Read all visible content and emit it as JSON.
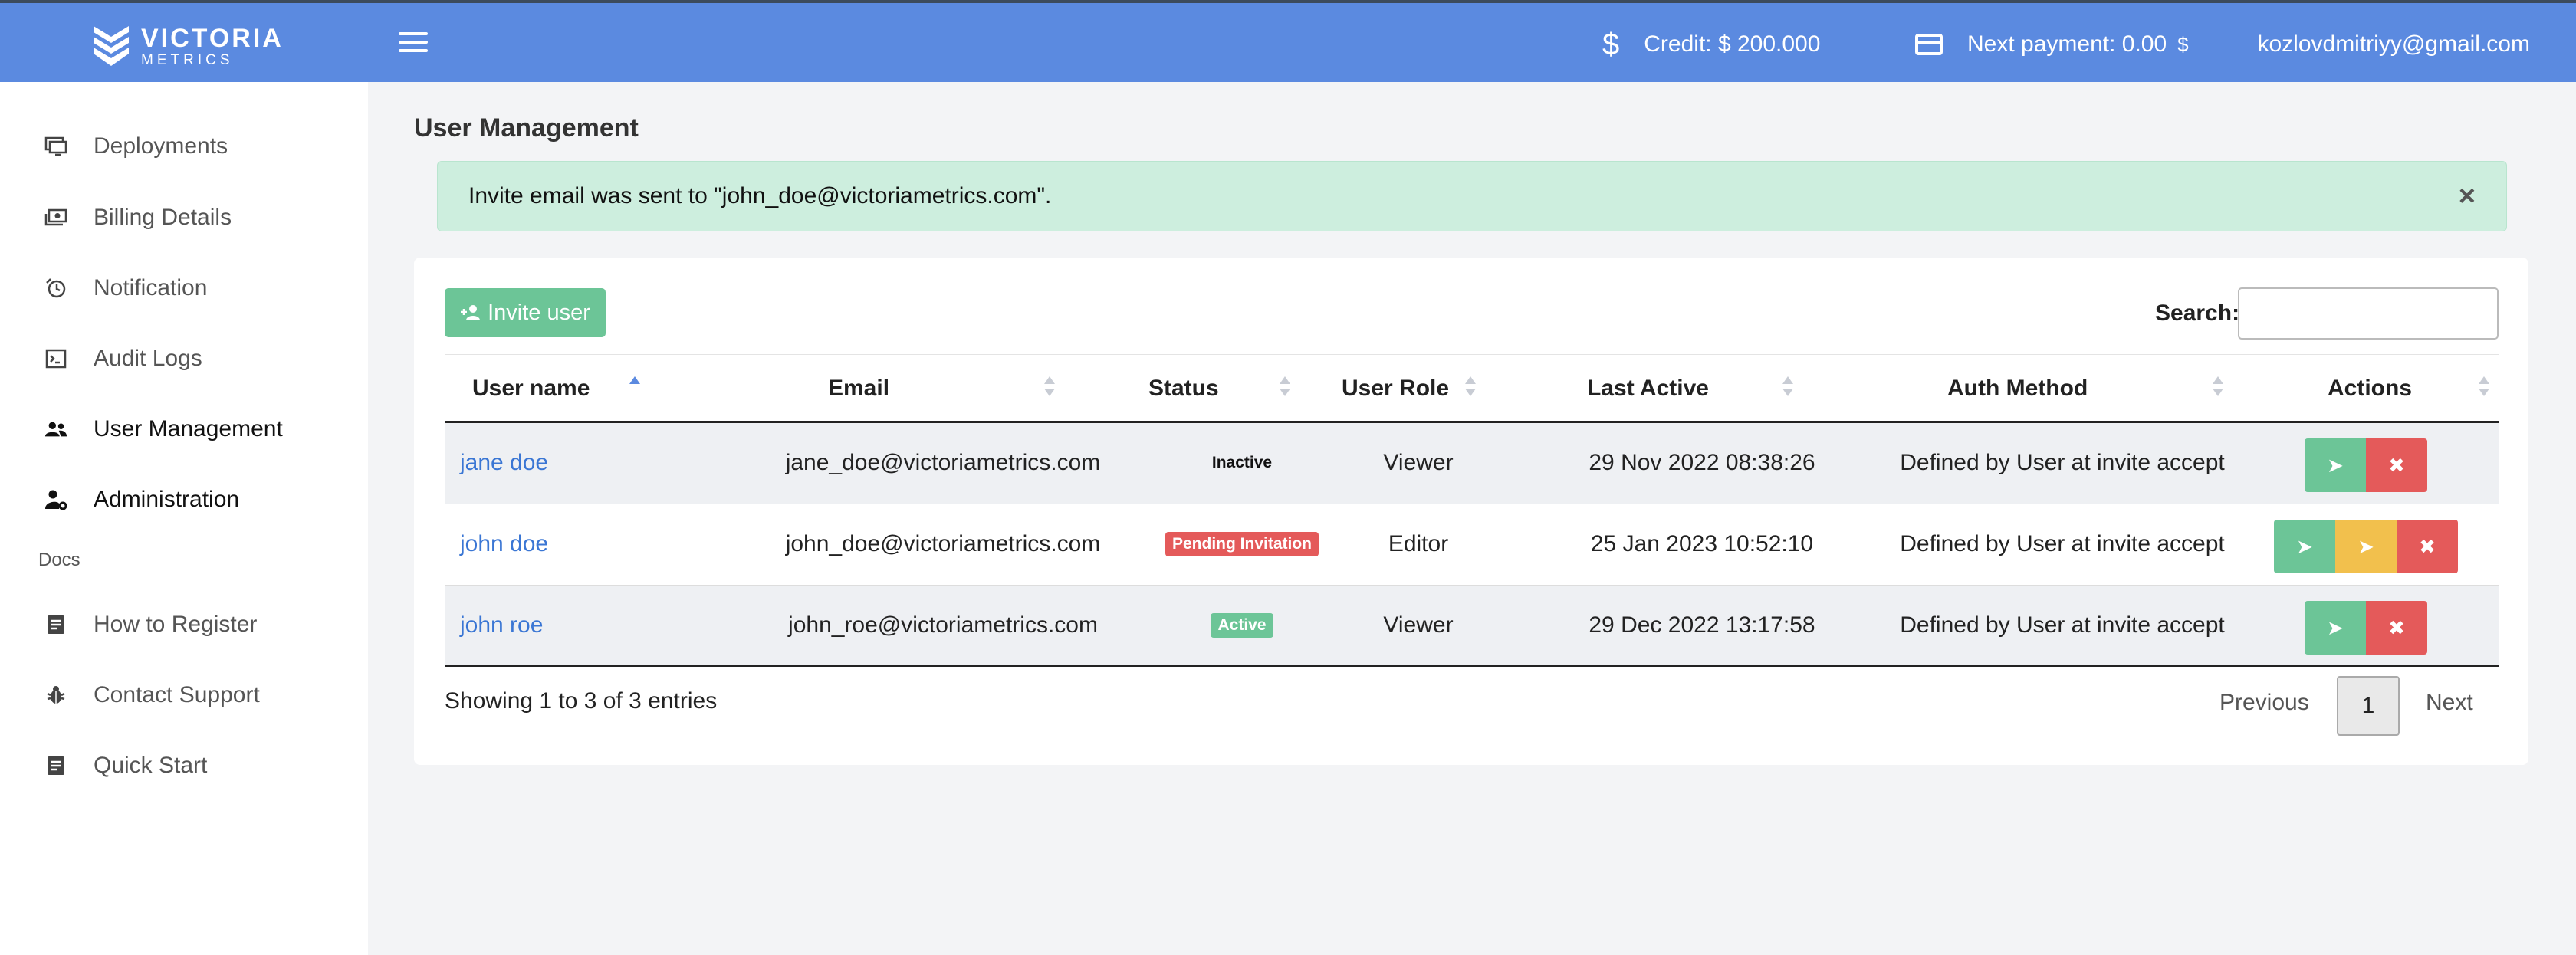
{
  "header": {
    "logo_main": "VICTORIA",
    "logo_sub": "METRICS",
    "credit": "Credit: $ 200.000",
    "next_payment": "Next payment: 0.00",
    "next_payment_currency": "$",
    "user_email": "kozlovdmitriyy@gmail.com",
    "brand_color": "#5b8ae0"
  },
  "sidebar": {
    "items": [
      {
        "label": "Deployments",
        "icon": "monitor-icon"
      },
      {
        "label": "Billing Details",
        "icon": "billing-icon"
      },
      {
        "label": "Notification",
        "icon": "alarm-icon"
      },
      {
        "label": "Audit Logs",
        "icon": "terminal-icon"
      },
      {
        "label": "User Management",
        "icon": "users-icon"
      },
      {
        "label": "Administration",
        "icon": "user-gear-icon"
      }
    ],
    "docs_header": "Docs",
    "docs_items": [
      {
        "label": "How to Register",
        "icon": "document-icon"
      },
      {
        "label": "Contact Support",
        "icon": "bug-icon"
      },
      {
        "label": "Quick Start",
        "icon": "document-icon"
      }
    ]
  },
  "main": {
    "title": "User Management",
    "alert": "Invite email was sent to \"john_doe@victoriametrics.com\".",
    "alert_close": "×",
    "invite_button": "Invite user",
    "search_label": "Search:",
    "search_value": "",
    "table": {
      "columns": [
        "User name",
        "Email",
        "Status",
        "User Role",
        "Last Active",
        "Auth Method",
        "Actions"
      ],
      "rows": [
        {
          "name": "jane doe",
          "email": "jane_doe@victoriametrics.com",
          "status": "Inactive",
          "role": "Viewer",
          "last_active": "29 Nov 2022 08:38:26",
          "auth": "Defined by User at invite accept"
        },
        {
          "name": "john doe",
          "email": "john_doe@victoriametrics.com",
          "status": "Pending Invitation",
          "role": "Editor",
          "last_active": "25 Jan 2023 10:52:10",
          "auth": "Defined by User at invite accept"
        },
        {
          "name": "john roe",
          "email": "john_roe@victoriametrics.com",
          "status": "Active",
          "role": "Viewer",
          "last_active": "29 Dec 2022 13:17:58",
          "auth": "Defined by User at invite accept"
        }
      ]
    },
    "showing": "Showing 1 to 3 of 3 entries",
    "pager": {
      "previous": "Previous",
      "page": "1",
      "next": "Next"
    }
  }
}
